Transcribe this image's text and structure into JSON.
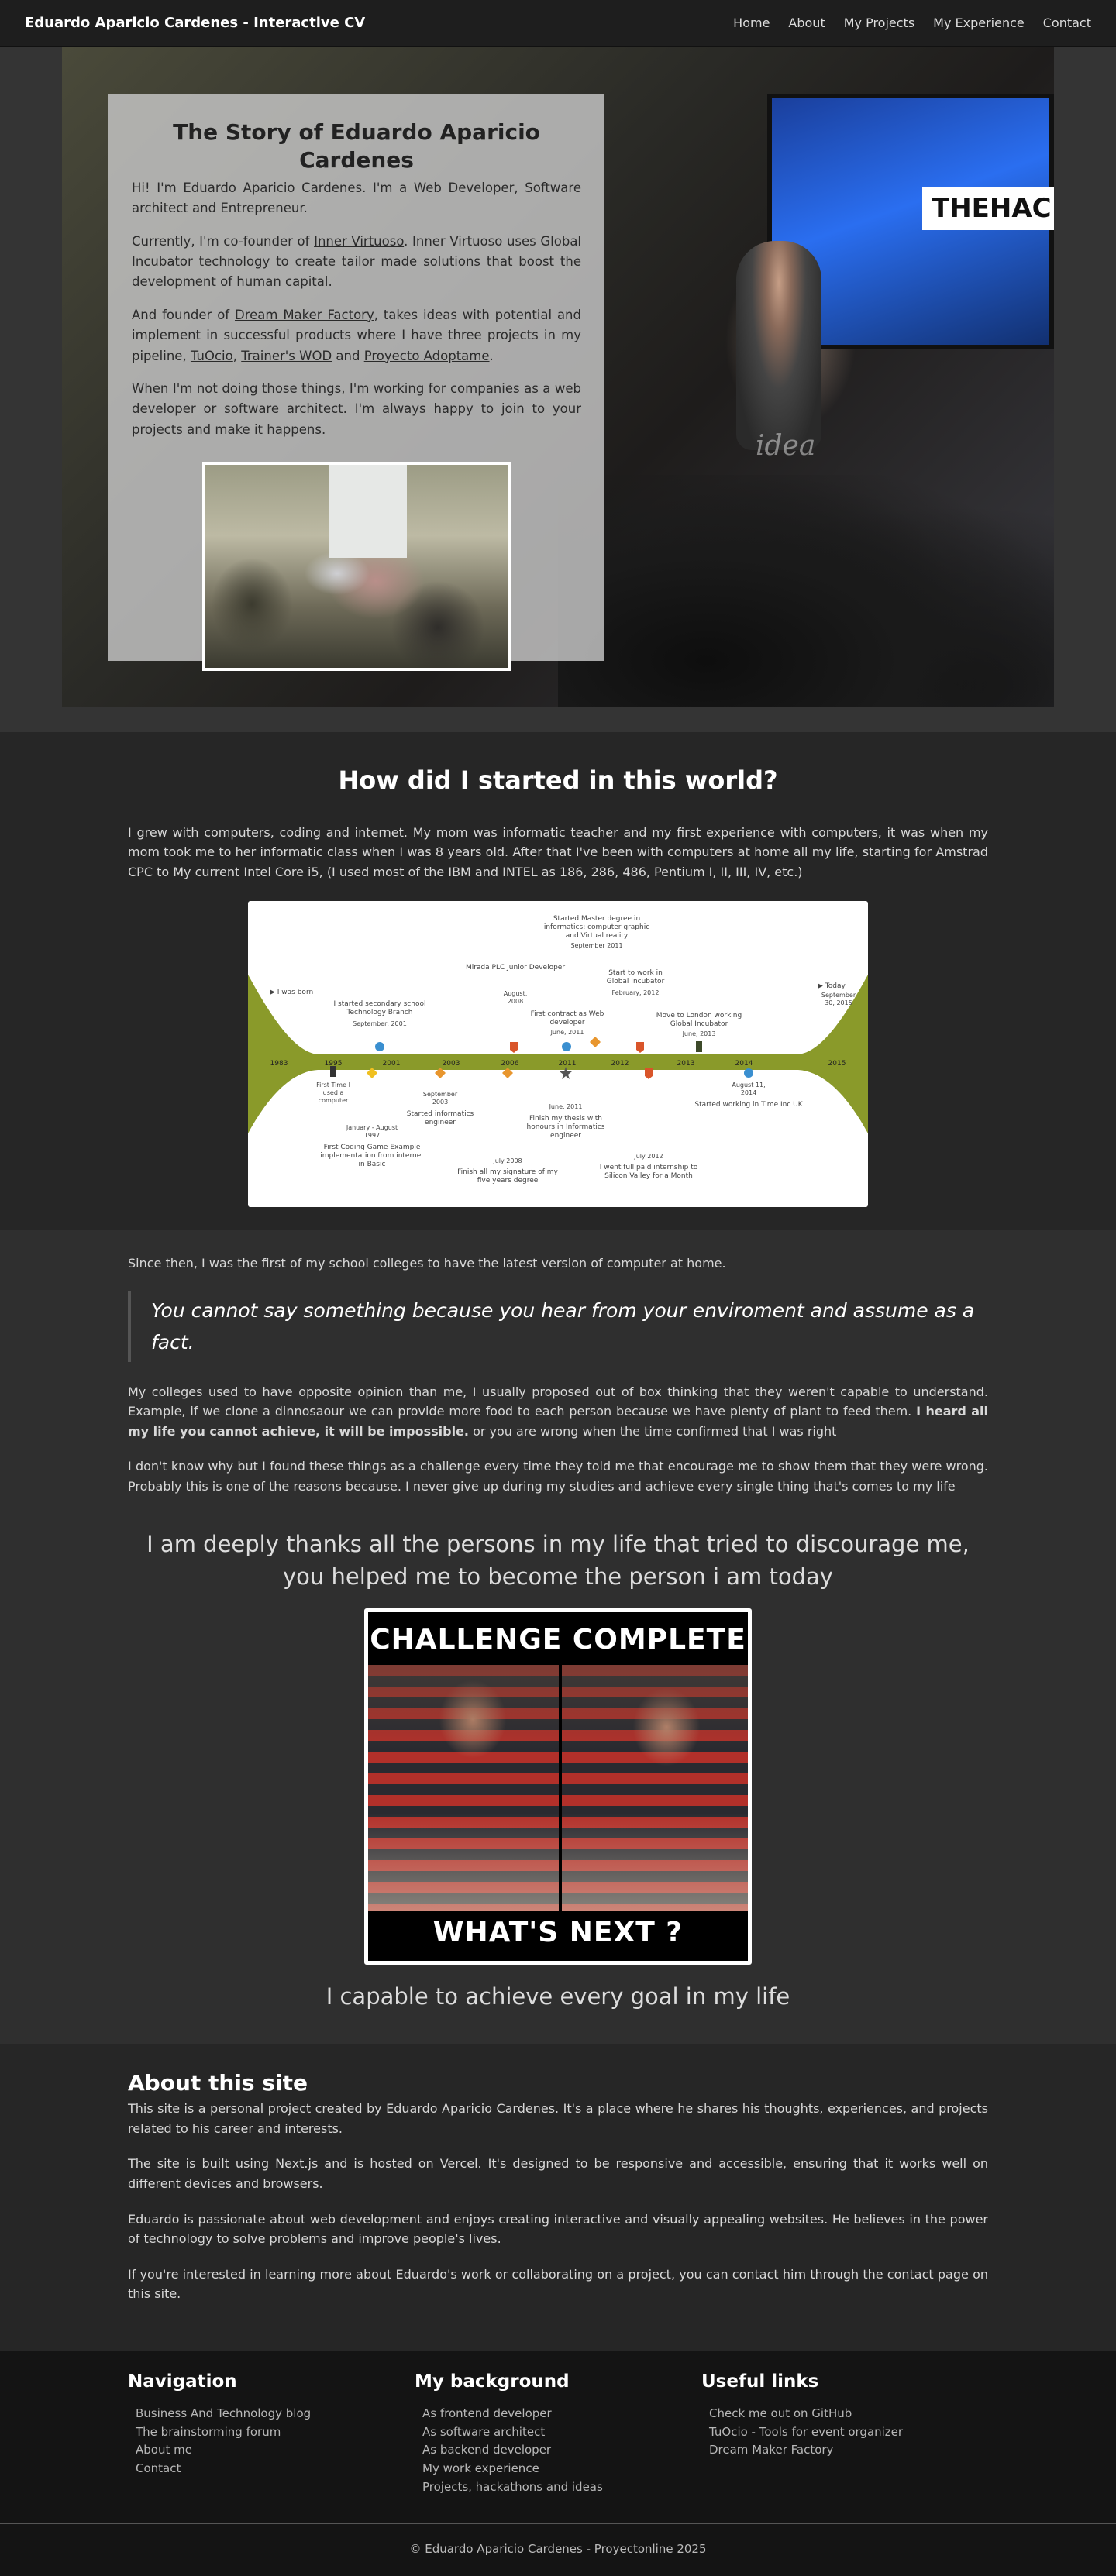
{
  "nav": {
    "brand": "Eduardo Aparicio Cardenes - Interactive CV",
    "links": [
      "Home",
      "About",
      "My Projects",
      "My Experience",
      "Contact"
    ]
  },
  "hero": {
    "title": "The Story of Eduardo Aparicio Cardenes",
    "p1": "Hi! I'm Eduardo Aparicio Cardenes. I'm a Web Developer, Software architect and Entrepreneur.",
    "p2_before": "Currently, I'm co-founder of ",
    "p2_link": "Inner Virtuoso",
    "p2_after": ". Inner Virtuoso uses Global Incubator technology to create tailor made solutions that boost the development of human capital.",
    "p3_before": "And founder of ",
    "p3_link": "Dream Maker Factory",
    "p3_mid": ", takes ideas with potential and implement in successful products where I have three projects in my pipeline, ",
    "p3_link2": "TuOcio",
    "p3_sep1": ", ",
    "p3_link3": "Trainer's WOD",
    "p3_sep2": " and ",
    "p3_link4": "Proyecto Adoptame",
    "p3_end": ".",
    "p4": "When I'm not doing those things, I'm working for companies as a web developer or software architect. I'm always happy to join to your projects and make it happens.",
    "screen_text": "THEHAC",
    "idea_text": "idea"
  },
  "started": {
    "heading": "How did I started in this world?",
    "paragraph": "I grew with computers, coding and internet. My mom was informatic teacher and my first experience with computers, it was when my mom took me to her informatic class when I was 8 years old. After that I've been with computers at home all my life, starting for Amstrad CPC to My current Intel Core i5, (I used most of the IBM and INTEL as 186, 286, 486, Pentium I, II, III, IV, etc.)"
  },
  "timeline": {
    "years": [
      "1983",
      "1995",
      "2001",
      "2003",
      "2006",
      "2011",
      "2012",
      "2013",
      "2014",
      "2015"
    ],
    "start_label": "I was born",
    "end_label": "Today",
    "end_date": "September 30, 2015",
    "events_top": [
      {
        "text": "I started secondary school Technology Branch",
        "date": "September, 2001"
      },
      {
        "text_link": "Mirada",
        "text": "PLC Junior Developer",
        "date": "August, 2008"
      },
      {
        "text": "Started Master degree in informatics: computer graphic and Virtual reality",
        "date": "September 2011"
      },
      {
        "text": "First contract as Web developer",
        "date": "June, 2011"
      },
      {
        "text": "Start to work in Global Incubator",
        "date": "February, 2012"
      },
      {
        "text": "Move to London working Global Incubator",
        "date": "June, 2013"
      }
    ],
    "events_bottom": [
      {
        "text": "First Time I used a computer",
        "date": ""
      },
      {
        "text": "First Coding Game Example implementation from internet in Basic",
        "date": "January - August, 1997"
      },
      {
        "text": "Started informatics engineer",
        "date": "September 2003"
      },
      {
        "text": "Finish all my signature of my five years degree",
        "date": "July 2008"
      },
      {
        "text": "Finish my thesis with honours in Informatics engineer",
        "date": "June, 2011"
      },
      {
        "text": "I went full paid internship to Silicon Valley for a Month",
        "date": "July 2012"
      },
      {
        "text_before": "Started working in Time ",
        "text_link": "Inc",
        "text_after": " UK",
        "date": "August 11, 2014"
      }
    ]
  },
  "story2": {
    "p1": "Since then, I was the first of my school colleges to have the latest version of computer at home.",
    "quote": "You cannot say something because you hear from your enviroment and assume as a fact.",
    "p2_before": "My colleges used to have opposite opinion than me, I usually proposed out of box thinking that they weren't capable to understand. Example, if we clone a dinnosaour we can provide more food to each person because we have plenty of plant to feed them. ",
    "p2_bold": "I heard all my life you cannot achieve, it will be impossible.",
    "p2_after": " or you are wrong when the time confirmed that I was right",
    "p3": "I don't know why but I found these things as a challenge every time they told me that encourage me to show them that they were wrong. Probably this is one of the reasons because. I never give up during my studies and achieve every single thing that's comes to my life",
    "thanks": "I am deeply thanks all the persons in my life that tried to discourage me, you helped me to become the person i am today",
    "challenge_top": "CHALLENGE  COMPLETE",
    "challenge_bottom": "WHAT'S NEXT ?",
    "capable": "I capable to achieve every goal in my life"
  },
  "about": {
    "heading": "About this site",
    "p1": "This site is a personal project created by Eduardo Aparicio Cardenes. It's a place where he shares his thoughts, experiences, and projects related to his career and interests.",
    "p2": "The site is built using Next.js and is hosted on Vercel. It's designed to be responsive and accessible, ensuring that it works well on different devices and browsers.",
    "p3": "Eduardo is passionate about web development and enjoys creating interactive and visually appealing websites. He believes in the power of technology to solve problems and improve people's lives.",
    "p4": "If you're interested in learning more about Eduardo's work or collaborating on a project, you can contact him through the contact page on this site."
  },
  "footer": {
    "navigation": {
      "heading": "Navigation",
      "items": [
        "Business And Technology blog",
        "The brainstorming forum",
        "About me",
        "Contact"
      ]
    },
    "background": {
      "heading": "My background",
      "items": [
        "As frontend developer",
        "As software architect",
        "As backend developer",
        "My work experience",
        "Projects, hackathons and ideas"
      ]
    },
    "links": {
      "heading": "Useful links",
      "items": [
        "Check me out on GitHub",
        "TuOcio - Tools for event organizer",
        "Dream Maker Factory"
      ]
    },
    "copyright": "© Eduardo Aparicio Cardenes - Proyectonline 2025"
  },
  "colors": {
    "page_bg": "#2b2b2b",
    "nav_bg": "#1e1e1e",
    "footer_bg": "#141414",
    "timeline_green": "#8a9a2a",
    "accent_orange": "#e8962e"
  }
}
